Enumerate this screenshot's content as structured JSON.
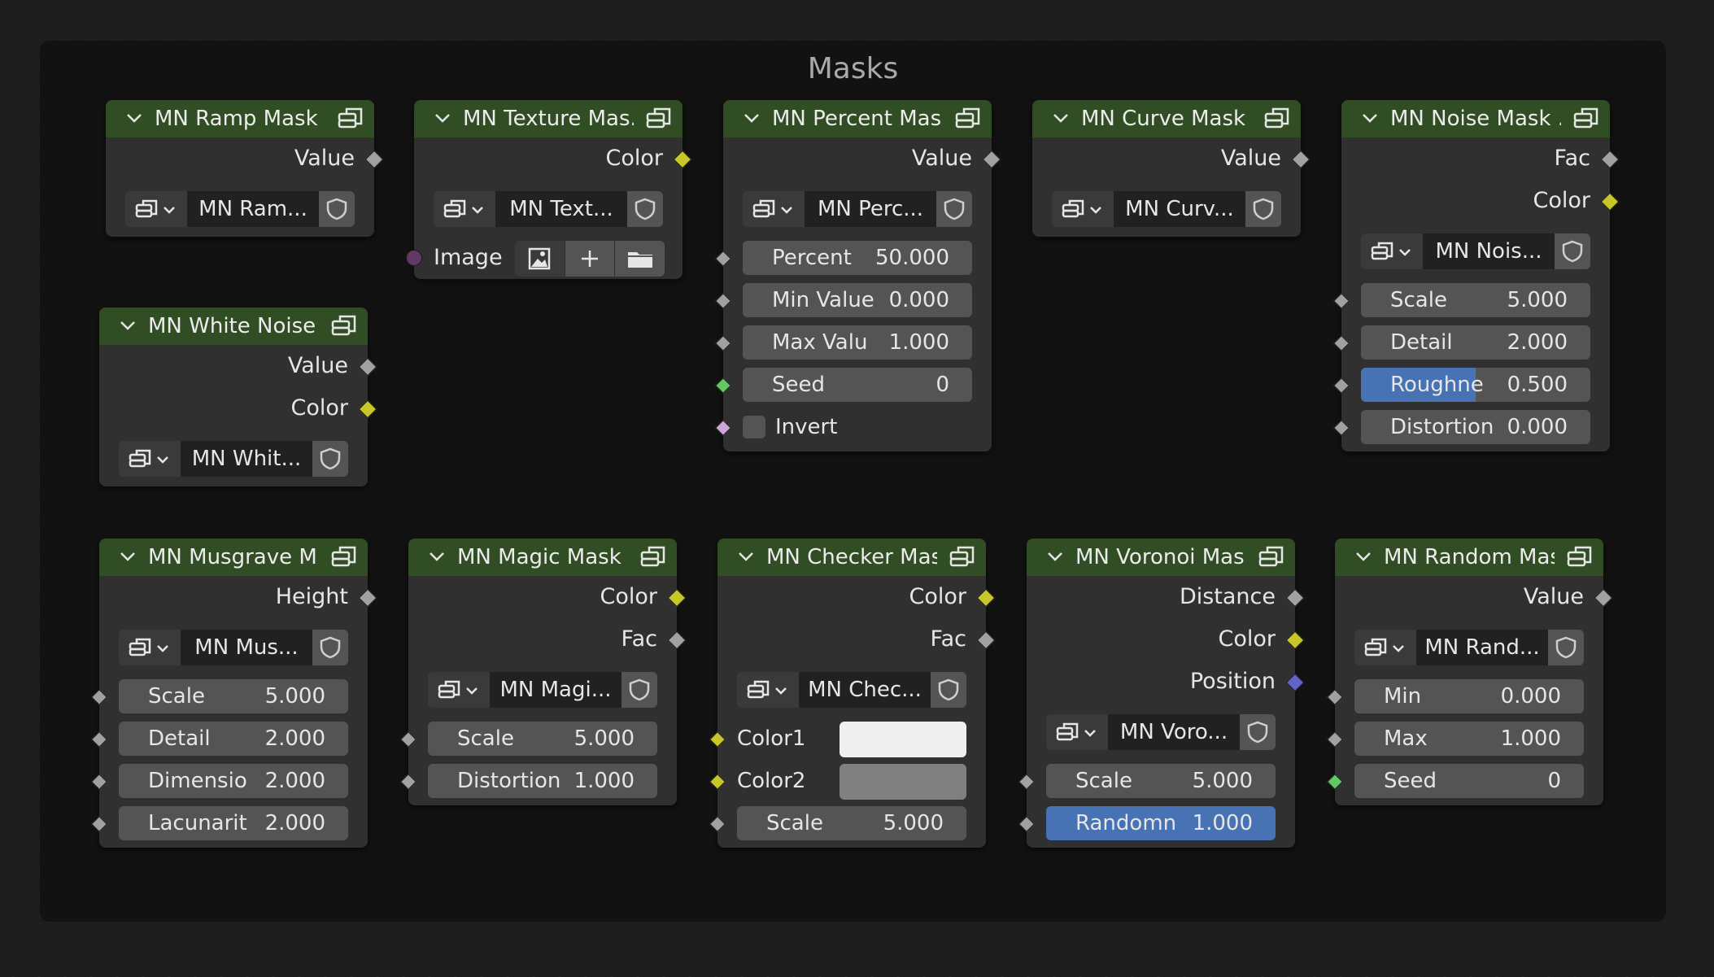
{
  "frame": {
    "title": "Masks"
  },
  "nodes": {
    "ramp": {
      "title": "MN Ramp Mask ...",
      "outputs": [
        "Value"
      ],
      "selector": "MN Ram..."
    },
    "texture": {
      "title": "MN Texture Mas...",
      "outputs": [
        "Color"
      ],
      "selector": "MN Text...",
      "image_label": "Image"
    },
    "percent": {
      "title": "MN Percent Mas...",
      "outputs": [
        "Value"
      ],
      "selector": "MN Perc...",
      "fields": [
        {
          "label": "Percent",
          "value": "50.000"
        },
        {
          "label": "Min Value",
          "value": "0.000"
        },
        {
          "label": "Max Valu",
          "value": "1.000"
        },
        {
          "label": "Seed",
          "value": "0"
        }
      ],
      "checkbox_label": "Invert"
    },
    "curve": {
      "title": "MN Curve Mask ...",
      "outputs": [
        "Value"
      ],
      "selector": "MN Curv..."
    },
    "noise": {
      "title": "MN Noise Mask ...",
      "outputs": [
        "Fac",
        "Color"
      ],
      "selector": "MN Nois...",
      "fields": [
        {
          "label": "Scale",
          "value": "5.000"
        },
        {
          "label": "Detail",
          "value": "2.000"
        },
        {
          "label": "Roughne",
          "value": "0.500"
        },
        {
          "label": "Distortion",
          "value": "0.000"
        }
      ],
      "roughness_fill": 0.5
    },
    "white_noise": {
      "title": "MN White Noise ...",
      "outputs": [
        "Value",
        "Color"
      ],
      "selector": "MN Whit..."
    },
    "musgrave": {
      "title": "MN Musgrave M...",
      "outputs": [
        "Height"
      ],
      "selector": "MN Mus...",
      "fields": [
        {
          "label": "Scale",
          "value": "5.000"
        },
        {
          "label": "Detail",
          "value": "2.000"
        },
        {
          "label": "Dimensio",
          "value": "2.000"
        },
        {
          "label": "Lacunarit",
          "value": "2.000"
        }
      ]
    },
    "magic": {
      "title": "MN Magic Mask ...",
      "outputs": [
        "Color",
        "Fac"
      ],
      "selector": "MN Magi...",
      "fields": [
        {
          "label": "Scale",
          "value": "5.000"
        },
        {
          "label": "Distortion",
          "value": "1.000"
        }
      ]
    },
    "checker": {
      "title": "MN Checker Mas...",
      "outputs": [
        "Color",
        "Fac"
      ],
      "selector": "MN Chec...",
      "colors": [
        {
          "label": "Color1",
          "swatch": "#efefef"
        },
        {
          "label": "Color2",
          "swatch": "#808080"
        }
      ],
      "fields": [
        {
          "label": "Scale",
          "value": "5.000"
        }
      ]
    },
    "voronoi": {
      "title": "MN Voronoi Mas...",
      "outputs": [
        "Distance",
        "Color",
        "Position"
      ],
      "selector": "MN Voro...",
      "fields": [
        {
          "label": "Scale",
          "value": "5.000"
        },
        {
          "label": "Randomn",
          "value": "1.000"
        }
      ]
    },
    "random": {
      "title": "MN Random Mas...",
      "outputs": [
        "Value"
      ],
      "selector": "MN Rand...",
      "fields": [
        {
          "label": "Min",
          "value": "0.000"
        },
        {
          "label": "Max",
          "value": "1.000"
        },
        {
          "label": "Seed",
          "value": "0"
        }
      ]
    }
  },
  "colors": {
    "header": "#304d24",
    "socket_float": "#a1a1a1",
    "socket_color": "#c7c729",
    "socket_int": "#63c763",
    "socket_bool": "#cca6d6",
    "socket_vector": "#6363c7",
    "selected_field": "#4772b3"
  }
}
